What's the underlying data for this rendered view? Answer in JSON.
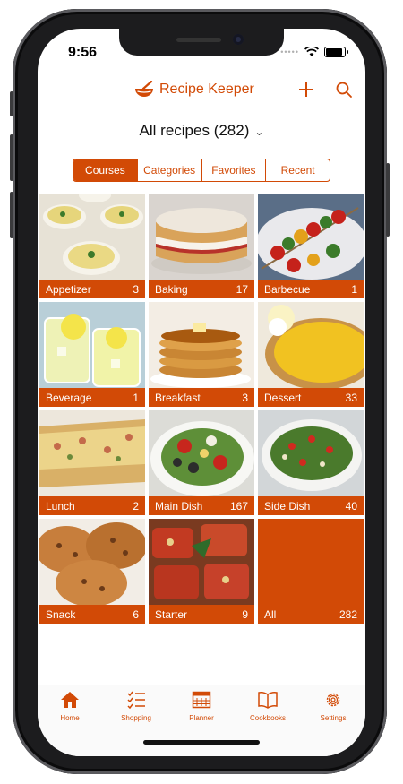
{
  "status_bar": {
    "time": "9:56",
    "signal_icon": "signal-dots-icon",
    "wifi_icon": "wifi-icon",
    "battery_icon": "battery-icon"
  },
  "header": {
    "app_icon": "bowl-icon",
    "title": "Recipe Keeper",
    "add_icon": "plus-icon",
    "search_icon": "search-icon"
  },
  "selector": {
    "label": "All recipes (282)",
    "icon": "chevron-down-icon"
  },
  "segments": [
    {
      "label": "Courses",
      "active": true
    },
    {
      "label": "Categories",
      "active": false
    },
    {
      "label": "Favorites",
      "active": false
    },
    {
      "label": "Recent",
      "active": false
    }
  ],
  "courses": [
    {
      "name": "Appetizer",
      "count": "3"
    },
    {
      "name": "Baking",
      "count": "17"
    },
    {
      "name": "Barbecue",
      "count": "1"
    },
    {
      "name": "Beverage",
      "count": "1"
    },
    {
      "name": "Breakfast",
      "count": "3"
    },
    {
      "name": "Dessert",
      "count": "33"
    },
    {
      "name": "Lunch",
      "count": "2"
    },
    {
      "name": "Main Dish",
      "count": "167"
    },
    {
      "name": "Side Dish",
      "count": "40"
    },
    {
      "name": "Snack",
      "count": "6"
    },
    {
      "name": "Starter",
      "count": "9"
    },
    {
      "name": "All",
      "count": "282"
    }
  ],
  "tabs": [
    {
      "label": "Home",
      "icon": "home-icon"
    },
    {
      "label": "Shopping",
      "icon": "checklist-icon"
    },
    {
      "label": "Planner",
      "icon": "calendar-icon"
    },
    {
      "label": "Cookbooks",
      "icon": "book-icon"
    },
    {
      "label": "Settings",
      "icon": "gear-icon"
    }
  ],
  "colors": {
    "accent": "#d24a06",
    "background": "#ffffff",
    "tab_bar": "#fafafa"
  }
}
